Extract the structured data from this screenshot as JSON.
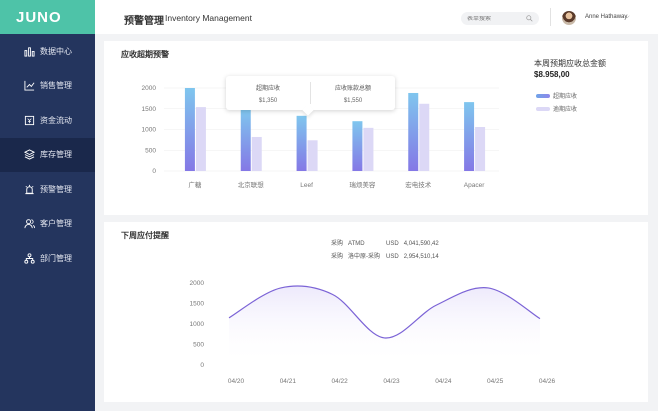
{
  "app": {
    "logo": "JUNO"
  },
  "sidebar": {
    "items": [
      {
        "label": "数据中心",
        "icon": "bar-chart-icon"
      },
      {
        "label": "销售管理",
        "icon": "trend-chart-icon"
      },
      {
        "label": "资金流动",
        "icon": "money-card-icon"
      },
      {
        "label": "库存管理",
        "icon": "layers-icon",
        "active": true
      },
      {
        "label": "预警管理",
        "icon": "alarm-icon"
      },
      {
        "label": "客户管理",
        "icon": "users-icon"
      },
      {
        "label": "部门管理",
        "icon": "org-chart-icon"
      }
    ]
  },
  "header": {
    "title": "预警管理",
    "subtitle": "Inventory  Management",
    "search_placeholder": "表单搜索",
    "username": "Anne Hathaway"
  },
  "card1": {
    "title": "应收超期预警",
    "total_label": "本周预期应收总金额",
    "total_value": "$8.958,00",
    "tooltip": {
      "col1_label": "超期应收",
      "col1_value": "$1,350",
      "col2_label": "应收账款总额",
      "col2_value": "$1,550"
    }
  },
  "card2": {
    "title": "下周应付提醒",
    "info_rows": [
      {
        "a": "采购",
        "b": "ATMD",
        "c": "USD",
        "d": "4,041,590,42"
      },
      {
        "a": "采购",
        "b": "洛中原-采购",
        "c": "USD",
        "d": "2,954,510,14"
      }
    ]
  },
  "chart_data": [
    {
      "type": "bar",
      "categories": [
        "广糖",
        "北京联想",
        "Leef",
        "瑞烦美容",
        "宏电技术",
        "Apacer"
      ],
      "series": [
        {
          "name": "超期应收",
          "values": [
            2000,
            1480,
            1330,
            1200,
            1880,
            1660
          ],
          "color": "#6fa4e8"
        },
        {
          "name": "逾期应收",
          "values": [
            1540,
            820,
            740,
            1040,
            1620,
            1060
          ],
          "color": "#dcd8f6"
        }
      ],
      "ylim": [
        0,
        2000
      ],
      "yticks": [
        0,
        500,
        1000,
        1500,
        2000
      ],
      "legend": "right"
    },
    {
      "type": "line",
      "x": [
        "04/20",
        "04/21",
        "04/22",
        "04/23",
        "04/24",
        "04/25",
        "04/26"
      ],
      "values": [
        1150,
        1880,
        1720,
        660,
        1460,
        1880,
        1130
      ],
      "ylim": [
        0,
        2000
      ],
      "yticks": [
        0,
        500,
        1000,
        1500,
        2000
      ],
      "color": "#7b63d6"
    }
  ]
}
